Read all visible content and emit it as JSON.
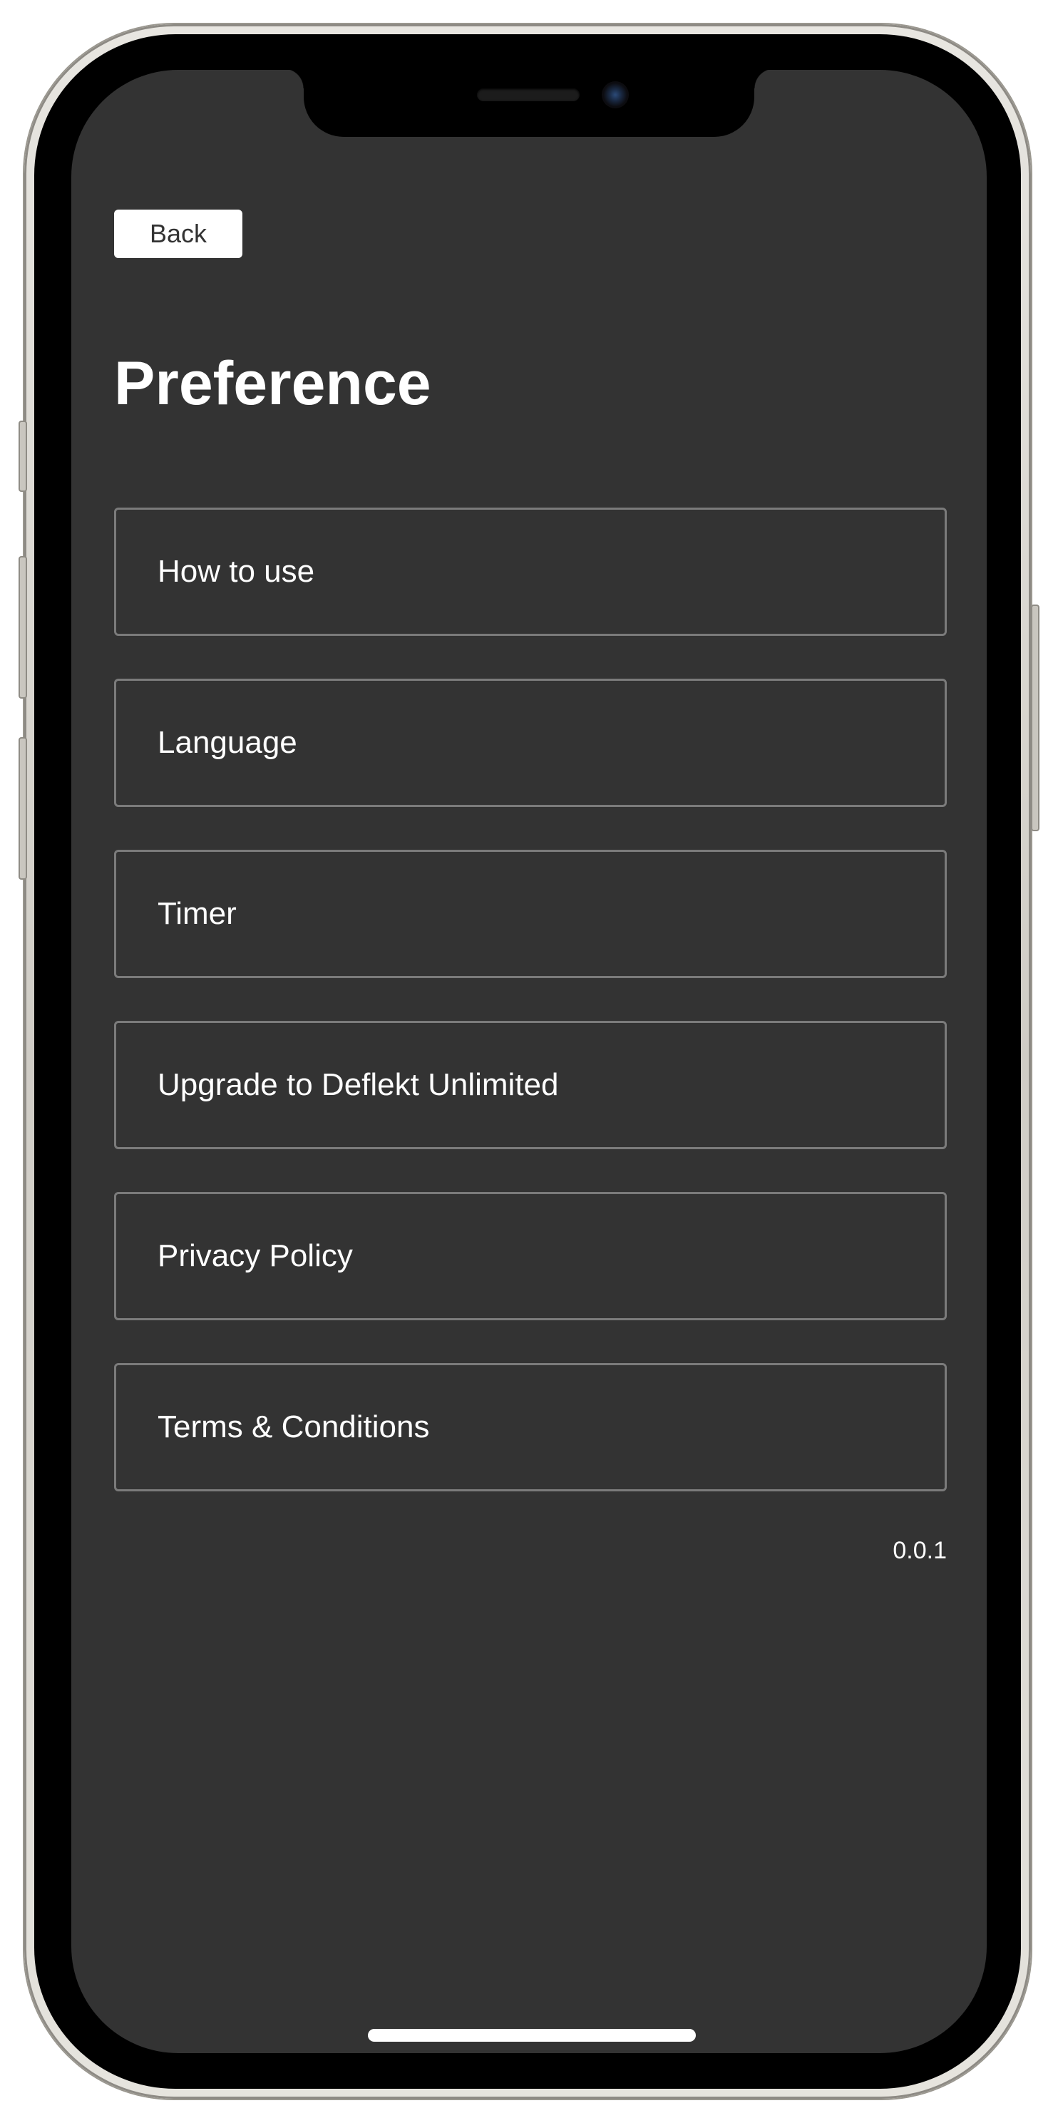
{
  "header": {
    "back_label": "Back",
    "title": "Preference"
  },
  "menu": {
    "items": [
      {
        "label": "How to use"
      },
      {
        "label": "Language"
      },
      {
        "label": "Timer"
      },
      {
        "label": "Upgrade to Deflekt Unlimited"
      },
      {
        "label": "Privacy Policy"
      },
      {
        "label": "Terms & Conditions"
      }
    ]
  },
  "footer": {
    "version": "0.0.1"
  },
  "colors": {
    "background": "#333333",
    "item_border": "#7b7b7b",
    "text": "#ffffff",
    "back_button_bg": "#ffffff"
  }
}
